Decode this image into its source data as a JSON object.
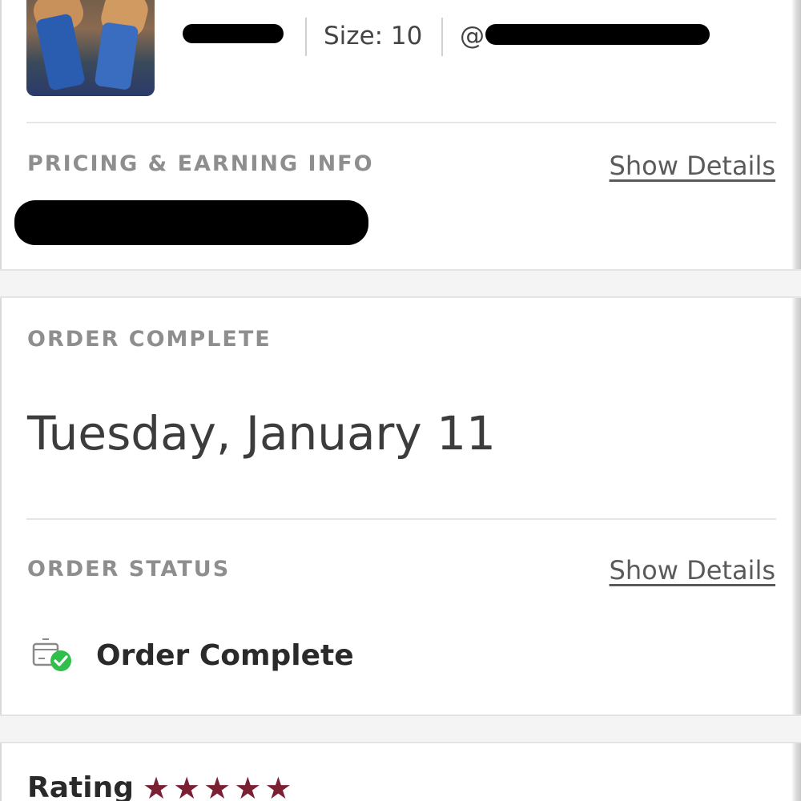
{
  "item": {
    "size_label": "Size: 10",
    "handle_prefix": "@"
  },
  "pricing": {
    "label": "PRICING & EARNING INFO",
    "details_link": "Show Details"
  },
  "order_complete": {
    "label": "ORDER COMPLETE",
    "date": "Tuesday, January 11"
  },
  "order_status": {
    "label": "ORDER STATUS",
    "details_link": "Show Details",
    "status_text": "Order Complete"
  },
  "rating": {
    "label": "Rating",
    "stars": 5,
    "max_stars": 5
  },
  "colors": {
    "star": "#7b1f33",
    "check_green": "#2fbf4a",
    "label_gray": "#8e8e8e"
  },
  "icons": {
    "status": "package-check-icon",
    "star": "star-icon"
  }
}
